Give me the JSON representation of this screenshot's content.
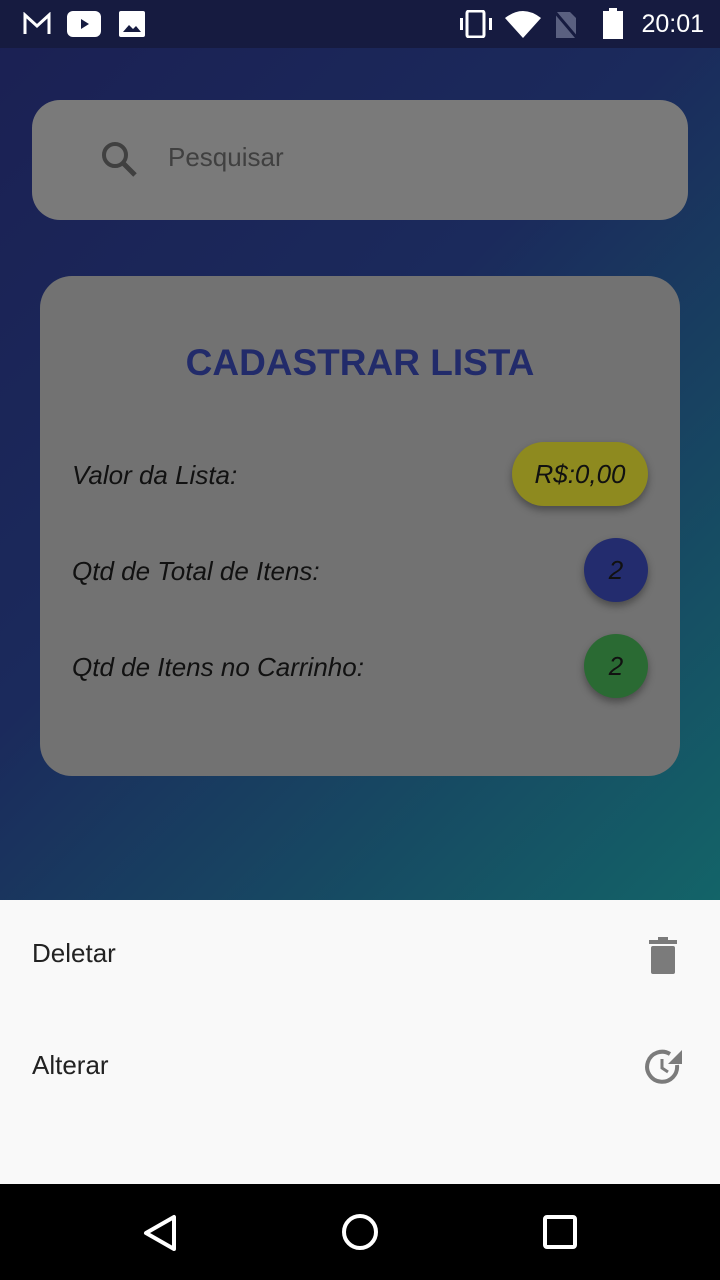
{
  "status": {
    "time": "20:01"
  },
  "search": {
    "placeholder": "Pesquisar"
  },
  "card": {
    "title": "CADASTRAR LISTA",
    "rows": [
      {
        "label": "Valor da Lista:",
        "value": "R$:0,00"
      },
      {
        "label": "Qtd de Total de Itens:",
        "value": "2"
      },
      {
        "label": "Qtd de Itens no Carrinho:",
        "value": "2"
      }
    ]
  },
  "sheet": {
    "items": [
      {
        "label": "Deletar"
      },
      {
        "label": "Alterar"
      }
    ]
  },
  "colors": {
    "value": "#8e8a1f",
    "total": "#232c6e",
    "cart": "#2a6a33"
  }
}
